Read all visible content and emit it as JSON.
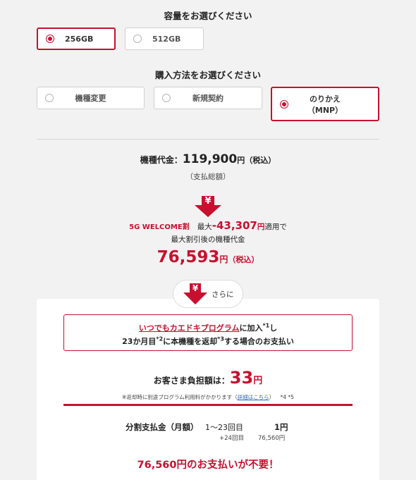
{
  "capacity": {
    "title": "容量をお選びください",
    "options": [
      {
        "label": "256GB",
        "selected": true
      },
      {
        "label": "512GB",
        "selected": false
      }
    ]
  },
  "purchase": {
    "title": "購入方法をお選びください",
    "options": [
      {
        "label": "機種変更",
        "selected": false
      },
      {
        "label": "新規契約",
        "selected": false
      },
      {
        "label_line1": "のりかえ",
        "label_line2": "（MNP）",
        "selected": true
      }
    ]
  },
  "price": {
    "label": "機種代金：",
    "amount": "119,900",
    "unit": "円",
    "tax": "（税込）",
    "note": "（支払総額）"
  },
  "welcome": {
    "yen_symbol": "¥",
    "name": "5G WELCOME割",
    "max_label": "最大",
    "discount": "-43,307",
    "unit": "円",
    "applied": "適用で",
    "after_label": "最大割引後の機種代金",
    "after_amount": "76,593",
    "after_unit": "円",
    "after_tax": "（税込）"
  },
  "further": {
    "yen_symbol": "¥",
    "label": "さらに"
  },
  "program": {
    "link_text": "いつでもカエドキプログラム",
    "line1_rest": "に加入",
    "sup1": "*1",
    "line1_end": "し",
    "line2_a": "23か月目",
    "sup2": "*2",
    "line2_b": "に本機種を返却",
    "sup3": "*3",
    "line2_c": "する場合のお支払い"
  },
  "burden": {
    "label": "お客さま負担額は：",
    "amount": "33",
    "unit": "円",
    "note_prefix": "※返却時に別途プログラム利用料がかかります（",
    "note_link": "詳細はこちら",
    "note_suffix": "）",
    "note_refs": "*4 *5"
  },
  "installments": {
    "label": "分割支払金（月額）",
    "period1": "1〜23回目",
    "amount1": "1円",
    "period2": "+24回目",
    "amount2": "76,560円"
  },
  "no_payment": "76,560円のお支払いが不要！",
  "colors": {
    "accent": "#c8102e",
    "background": "#f2f2f2",
    "link": "#3a66c4"
  }
}
